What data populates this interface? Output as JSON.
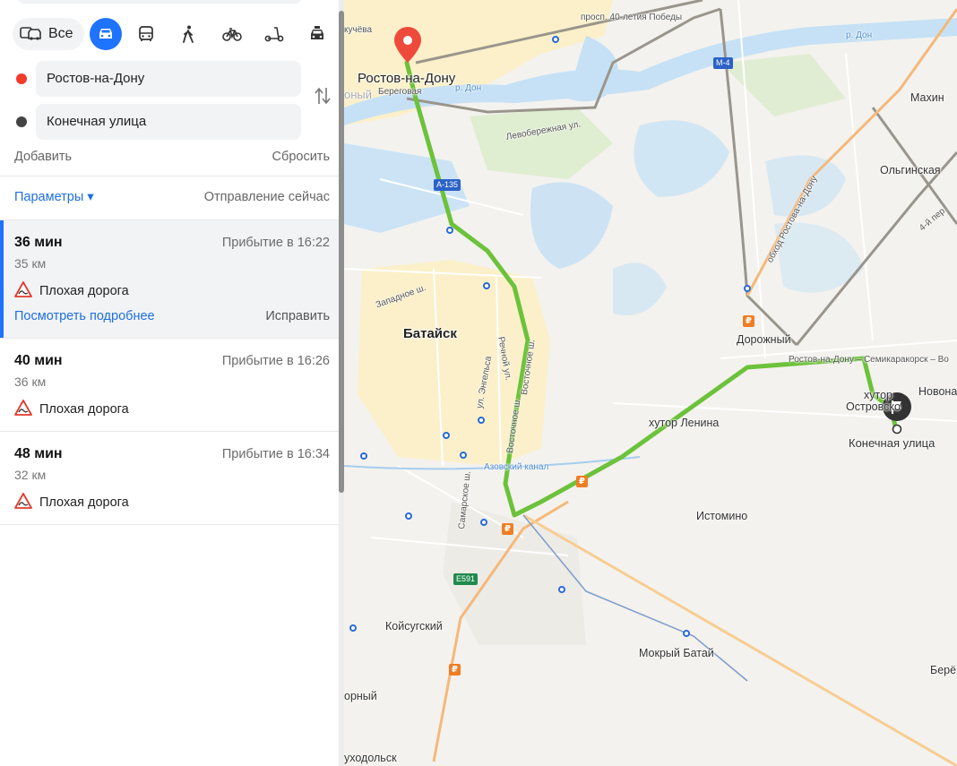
{
  "modes": {
    "all_label": "Все",
    "items": [
      {
        "name": "car",
        "active": true
      },
      {
        "name": "bus",
        "active": false
      },
      {
        "name": "walk",
        "active": false
      },
      {
        "name": "bike",
        "active": false
      },
      {
        "name": "scooter",
        "active": false
      },
      {
        "name": "taxi",
        "active": false
      }
    ]
  },
  "points": {
    "from": "Ростов-на-Дону",
    "to": "Конечная улица",
    "from_color": "#f33b2b",
    "to_color": "#444444"
  },
  "actions": {
    "add": "Добавить",
    "reset": "Сбросить"
  },
  "params": {
    "label": "Параметры ▾",
    "departure": "Отправление сейчас"
  },
  "routes": [
    {
      "time": "36 мин",
      "arrival": "Прибытие в 16:22",
      "distance": "35 км",
      "warning": "Плохая дорога",
      "details": "Посмотреть подробнее",
      "fix": "Исправить",
      "active": true
    },
    {
      "time": "40 мин",
      "arrival": "Прибытие в 16:26",
      "distance": "36 км",
      "warning": "Плохая дорога",
      "active": false
    },
    {
      "time": "48 мин",
      "arrival": "Прибытие в 16:34",
      "distance": "32 км",
      "warning": "Плохая дорога",
      "active": false
    }
  ],
  "map": {
    "colors": {
      "route": "#6cc23a",
      "water": "#c6e1f5",
      "city": "#fbf0c9",
      "highway": "#f5b87a"
    },
    "places": {
      "rostov": "Ростов-на-Дону",
      "rostov_cut": "оный",
      "bataysk": "Батайск",
      "olginskaya": "Ольгинская",
      "makhin": "Махин",
      "dorozhny": "Дорожный",
      "khutor_lenina": "хутор Ленина",
      "khutor": "хутор",
      "ostrovsky": "Островско",
      "novona": "Новона",
      "destination": "Конечная улица",
      "istomino": "Истомино",
      "koysugsky": "Койсугский",
      "mokry_batay": "Мокрый Батай",
      "berez": "Берё",
      "orny": "орный",
      "ukhodolsk": "уходольск",
      "zapadnoe": "Западное ш.",
      "engelsa": "ул. Энгельса",
      "vostochnoe": "Восточное ш.",
      "vostochnoe2": "Восточное ш.",
      "rechnoy": "Речной ул.",
      "samarskoe": "Самарское ш.",
      "azov_canal": "Азовский канал",
      "river_don": "р. Дон",
      "river_don2": "р. Дон",
      "prosp": "просп. 40-летия Победы",
      "levoberezh": "Левобережная ул.",
      "beregovaya": "Береговая",
      "obkhod": "обход Ростова-на-Дону",
      "rostov_semikar": "Ростов-на-Дону – Семикаракорск – Во",
      "chucheva": "кучёва",
      "a4": "4-й пер."
    },
    "shields": {
      "a135": "А-135",
      "m4": "М-4",
      "e591": "Е591"
    }
  }
}
